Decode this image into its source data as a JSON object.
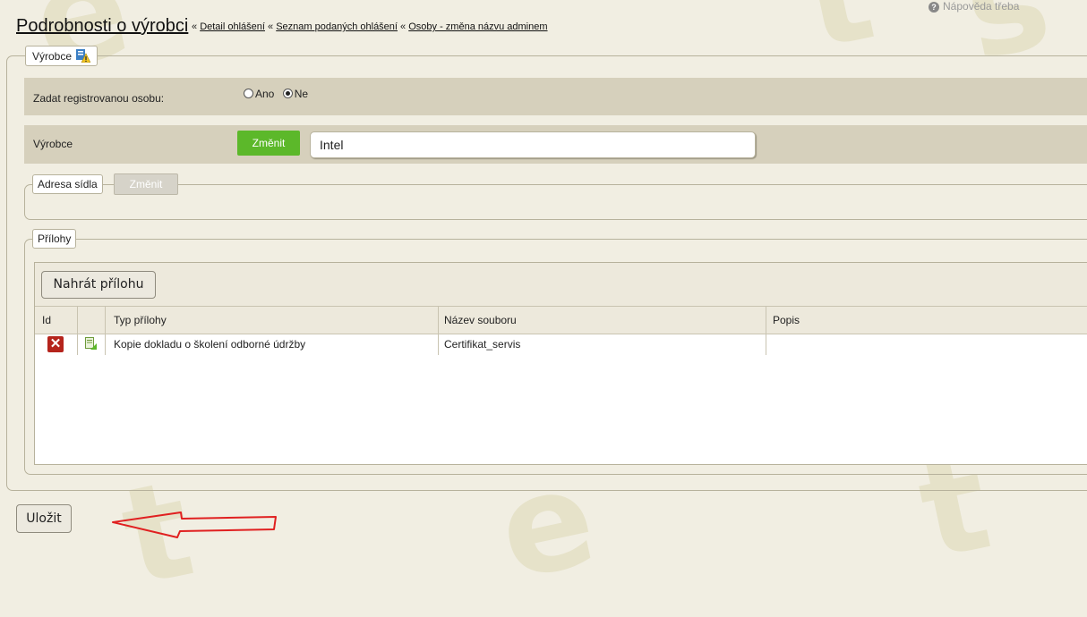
{
  "header": {
    "page_title": "Podrobnosti o výrobci",
    "sep": "«",
    "crumbs": [
      "Detail ohlášení",
      "Seznam podaných ohlášení",
      "Osoby - změna názvu adminem"
    ],
    "help_label": "Nápověda třeba"
  },
  "vyrobce_section": {
    "legend": "Výrobce",
    "register_label": "Zadat registrovanou osobu:",
    "radio_yes": "Ano",
    "radio_no": "Ne",
    "radio_selected": "Ne",
    "field_label": "Výrobce",
    "change_label": "Změnit",
    "value": "Intel"
  },
  "address_section": {
    "legend": "Adresa sídla",
    "change_label": "Změnit"
  },
  "attachments": {
    "legend": "Přílohy",
    "upload_label": "Nahrát přílohu",
    "columns": [
      "Id",
      "",
      "Typ přílohy",
      "Název souboru",
      "Popis"
    ],
    "rows": [
      {
        "type": "Kopie dokladu o školení odborné údržby",
        "filename": "Certifikat_servis",
        "desc": ""
      }
    ]
  },
  "footer": {
    "save_label": "Uložit"
  },
  "colors": {
    "accent_green": "#5cb82a",
    "band": "#d6d0bc",
    "arrow": "#e02020"
  }
}
